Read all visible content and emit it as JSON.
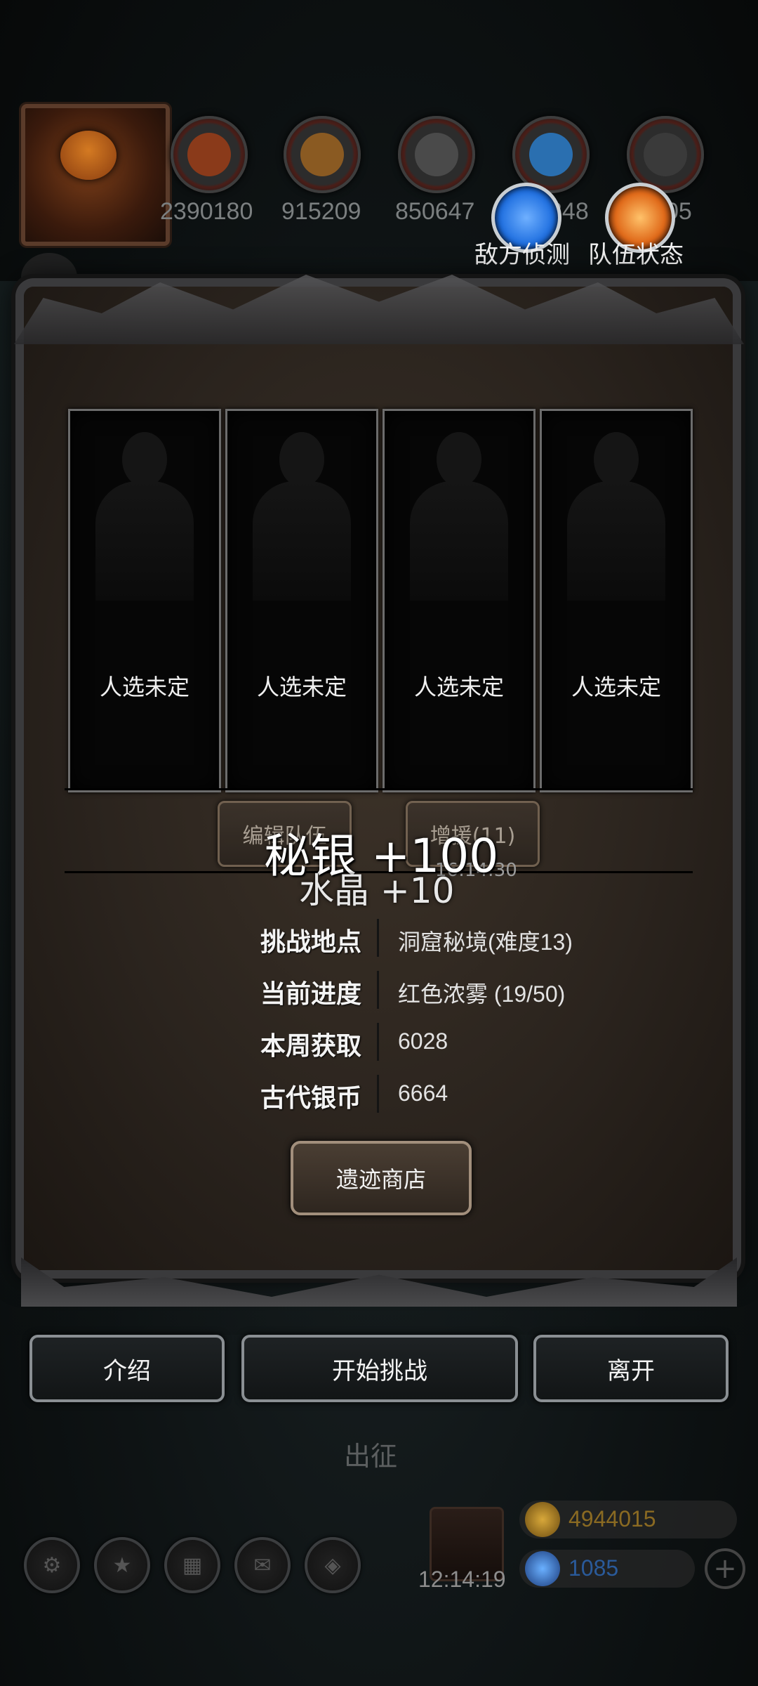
{
  "resources": [
    {
      "icon": "copper-ore-icon",
      "value": "2390180",
      "color": "#8a3a1a"
    },
    {
      "icon": "wood-planks-icon",
      "value": "915209",
      "color": "#8a5a22"
    },
    {
      "icon": "iron-ingot-icon",
      "value": "850647",
      "color": "#4a4a4a"
    },
    {
      "icon": "blue-crystal-icon",
      "value": "348",
      "color": "#2a6fb0"
    },
    {
      "icon": "black-stone-icon",
      "value": "05",
      "color": "#3a3a3a"
    }
  ],
  "top_buttons": {
    "scout_label": "敌方侦测",
    "team_label": "队伍状态"
  },
  "slots": [
    {
      "label": "人选未定"
    },
    {
      "label": "人选未定"
    },
    {
      "label": "人选未定"
    },
    {
      "label": "人选未定"
    }
  ],
  "mid_buttons": {
    "edit_label": "编辑队伍",
    "boost_label": "增援(11)"
  },
  "floating": {
    "reward1": "秘银 +100",
    "reward2": "水晶 +10",
    "timer": "16:14:30"
  },
  "info": [
    {
      "label": "挑战地点",
      "value": "洞窟秘境(难度13)"
    },
    {
      "label": "当前进度",
      "value": "红色浓雾 (19/50)"
    },
    {
      "label": "本周获取",
      "value": "6028"
    },
    {
      "label": "古代银币",
      "value": "6664"
    }
  ],
  "shop_label": "遗迹商店",
  "actions": {
    "intro": "介绍",
    "start": "开始挑战",
    "leave": "离开"
  },
  "chuzheng": "出征",
  "bottom": {
    "timer": "12:14:19",
    "gold": "4944015",
    "gems": "1085"
  },
  "colors": {
    "gold_text": "#8a6a22",
    "gem_text": "#2a5a9a",
    "scout_orb": "#1f6fe0",
    "team_orb": "#e06a1a"
  }
}
